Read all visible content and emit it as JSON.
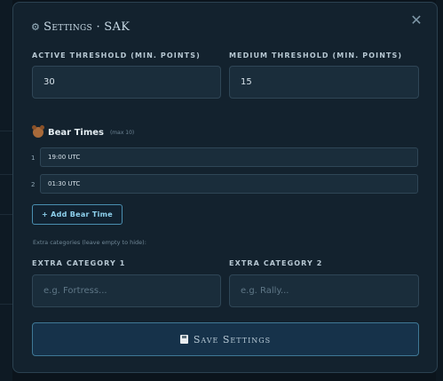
{
  "modal": {
    "title_icon": "⚙",
    "title": "Settings · SAK",
    "close_icon": "✕"
  },
  "thresholds": {
    "active_label": "Active Threshold (min. points)",
    "active_value": "30",
    "medium_label": "Medium Threshold (min. points)",
    "medium_value": "15"
  },
  "bear": {
    "title": "Bear Times",
    "note": "(max 10)",
    "rows": [
      {
        "index": "1",
        "value": "19:00 UTC"
      },
      {
        "index": "2",
        "value": "01:30 UTC"
      }
    ],
    "add_label": "+ Add Bear Time"
  },
  "extras": {
    "hint": "Extra categories (leave empty to hide):",
    "cat1_label": "Extra Category 1",
    "cat1_placeholder": "e.g. Fortress...",
    "cat2_label": "Extra Category 2",
    "cat2_placeholder": "e.g. Rally..."
  },
  "save_label": "Save Settings",
  "colors": {
    "accent": "#4a8fb0",
    "modal_bg": "#13222e",
    "input_bg": "#1a2d3b"
  }
}
